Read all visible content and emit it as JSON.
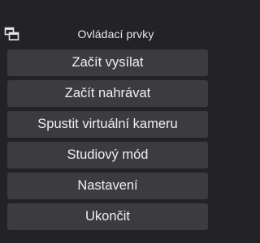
{
  "dock": {
    "title": "Ovládací prvky",
    "icon": "dock-undock-icon"
  },
  "controls": {
    "start_streaming": "Začít vysílat",
    "start_recording": "Začít nahrávat",
    "start_virtual_camera": "Spustit virtuální kameru",
    "studio_mode": "Studiový mód",
    "settings": "Nastavení",
    "exit": "Ukončit"
  },
  "colors": {
    "background": "#232327",
    "button": "#3b3b40",
    "text": "#f0f0f2"
  }
}
